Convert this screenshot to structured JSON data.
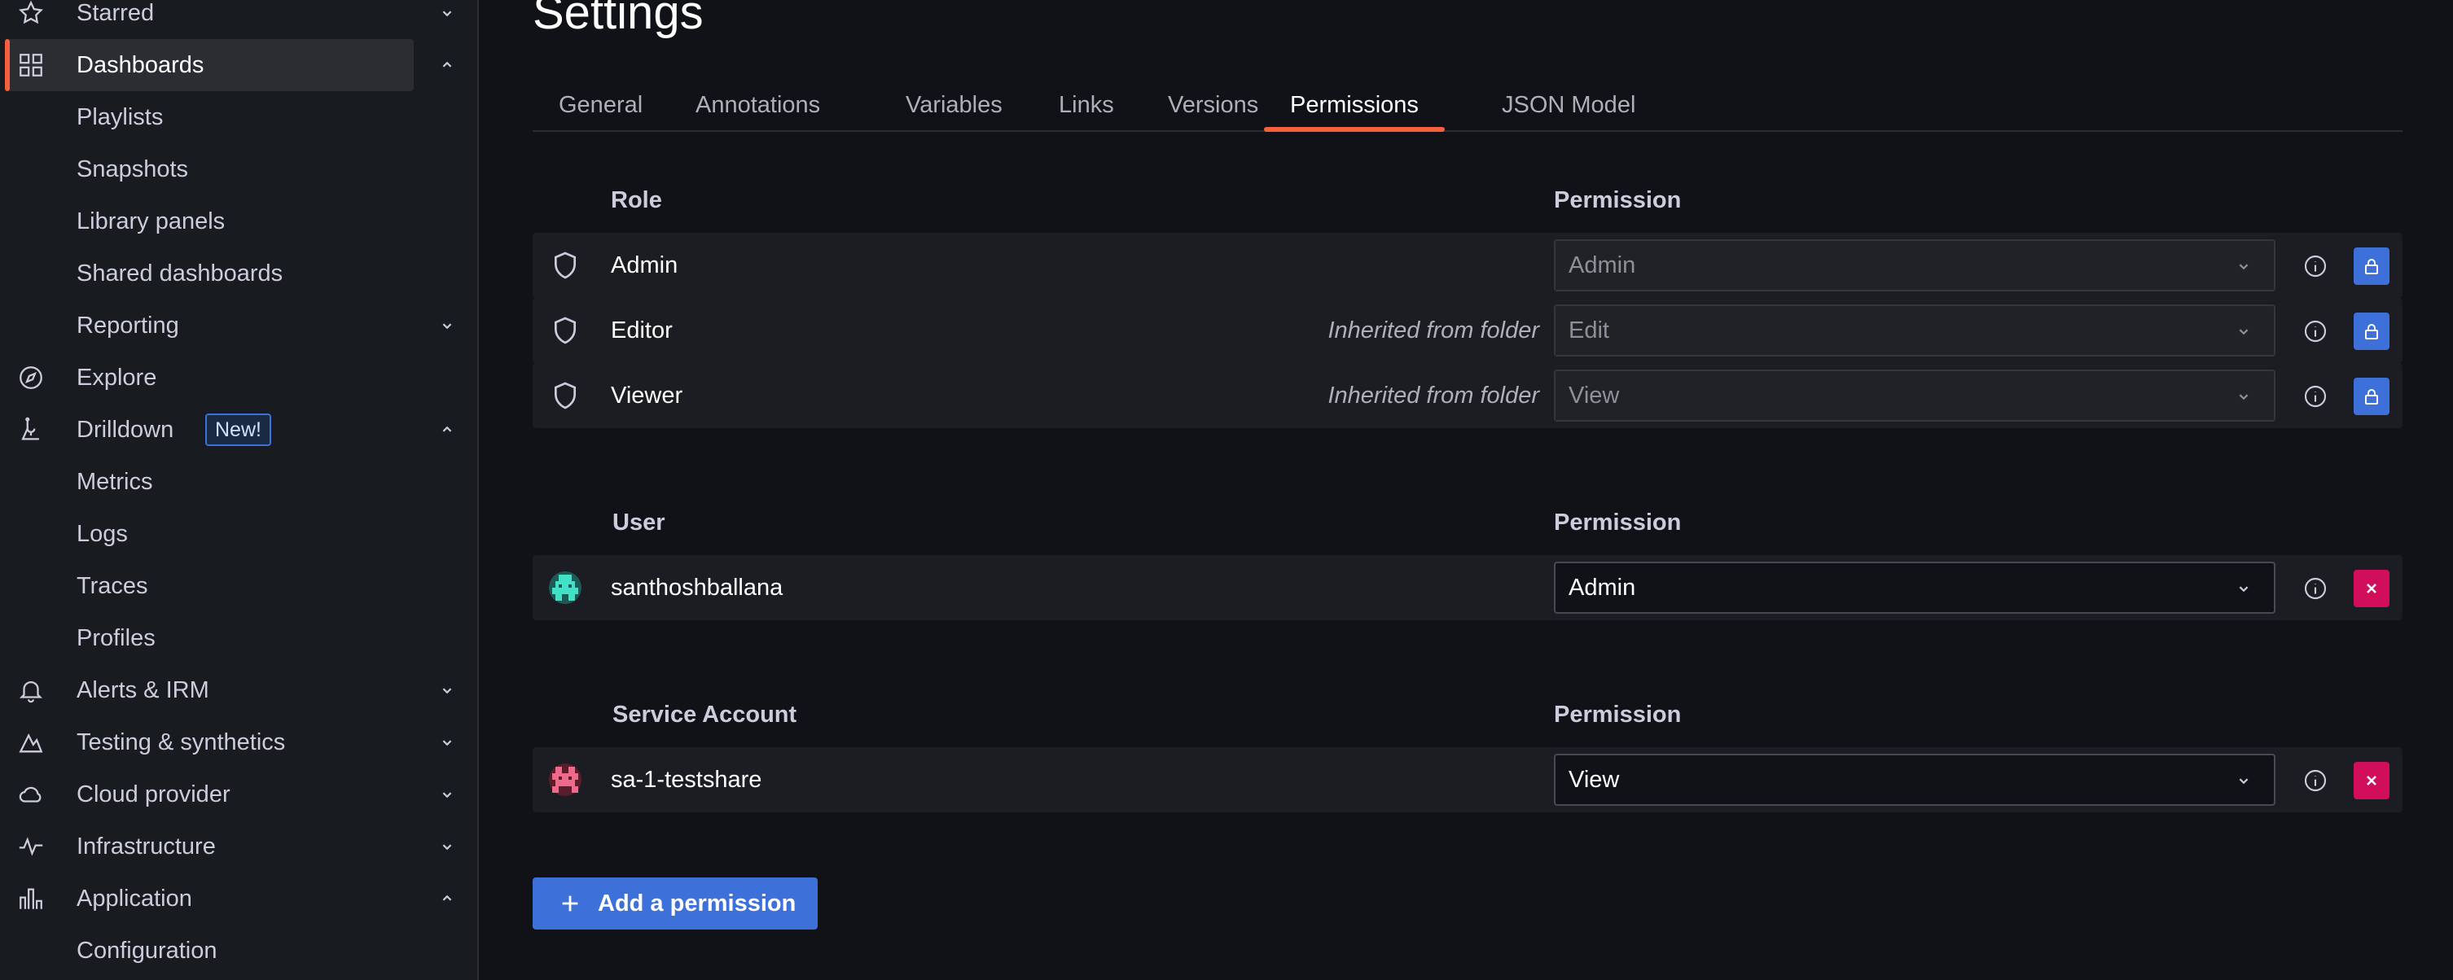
{
  "sidebar": {
    "items": [
      {
        "label": "Starred",
        "icon": "star-icon",
        "chevron": "down"
      },
      {
        "label": "Dashboards",
        "icon": "dashboards-grid-icon",
        "chevron": "up",
        "active": true
      },
      {
        "label": "Playlists"
      },
      {
        "label": "Snapshots"
      },
      {
        "label": "Library panels"
      },
      {
        "label": "Shared dashboards"
      },
      {
        "label": "Reporting",
        "chevron": "down"
      },
      {
        "label": "Explore",
        "icon": "compass-icon"
      },
      {
        "label": "Drilldown",
        "icon": "drilldown-icon",
        "chevron": "up",
        "badge": "New!"
      },
      {
        "label": "Metrics"
      },
      {
        "label": "Logs"
      },
      {
        "label": "Traces"
      },
      {
        "label": "Profiles"
      },
      {
        "label": "Alerts & IRM",
        "icon": "bell-icon",
        "chevron": "down"
      },
      {
        "label": "Testing & synthetics",
        "icon": "synthetics-icon",
        "chevron": "down"
      },
      {
        "label": "Cloud provider",
        "icon": "cloud-icon",
        "chevron": "down"
      },
      {
        "label": "Infrastructure",
        "icon": "heartbeat-icon",
        "chevron": "down"
      },
      {
        "label": "Application",
        "icon": "bar-chart-icon",
        "chevron": "up"
      },
      {
        "label": "Configuration"
      }
    ]
  },
  "page": {
    "title": "Settings"
  },
  "tabs": [
    "General",
    "Annotations",
    "Variables",
    "Links",
    "Versions",
    "Permissions",
    "JSON Model"
  ],
  "active_tab": "Permissions",
  "sections": {
    "role": {
      "header": "Role",
      "permission_header": "Permission",
      "rows": [
        {
          "name": "Admin",
          "inherited": "",
          "permission": "Admin"
        },
        {
          "name": "Editor",
          "inherited": "Inherited from folder",
          "permission": "Edit"
        },
        {
          "name": "Viewer",
          "inherited": "Inherited from folder",
          "permission": "View"
        }
      ]
    },
    "user": {
      "header": "User",
      "permission_header": "Permission",
      "rows": [
        {
          "name": "santhoshballana",
          "permission": "Admin"
        }
      ]
    },
    "service_account": {
      "header": "Service Account",
      "permission_header": "Permission",
      "rows": [
        {
          "name": "sa-1-testshare",
          "permission": "View"
        }
      ]
    }
  },
  "actions": {
    "add_permission": "Add a permission"
  },
  "colors": {
    "accent": "#f55f3e",
    "primary": "#3d71d9",
    "destructive": "#d10e5c",
    "background": "#111217",
    "sidebar": "#181b1f"
  }
}
